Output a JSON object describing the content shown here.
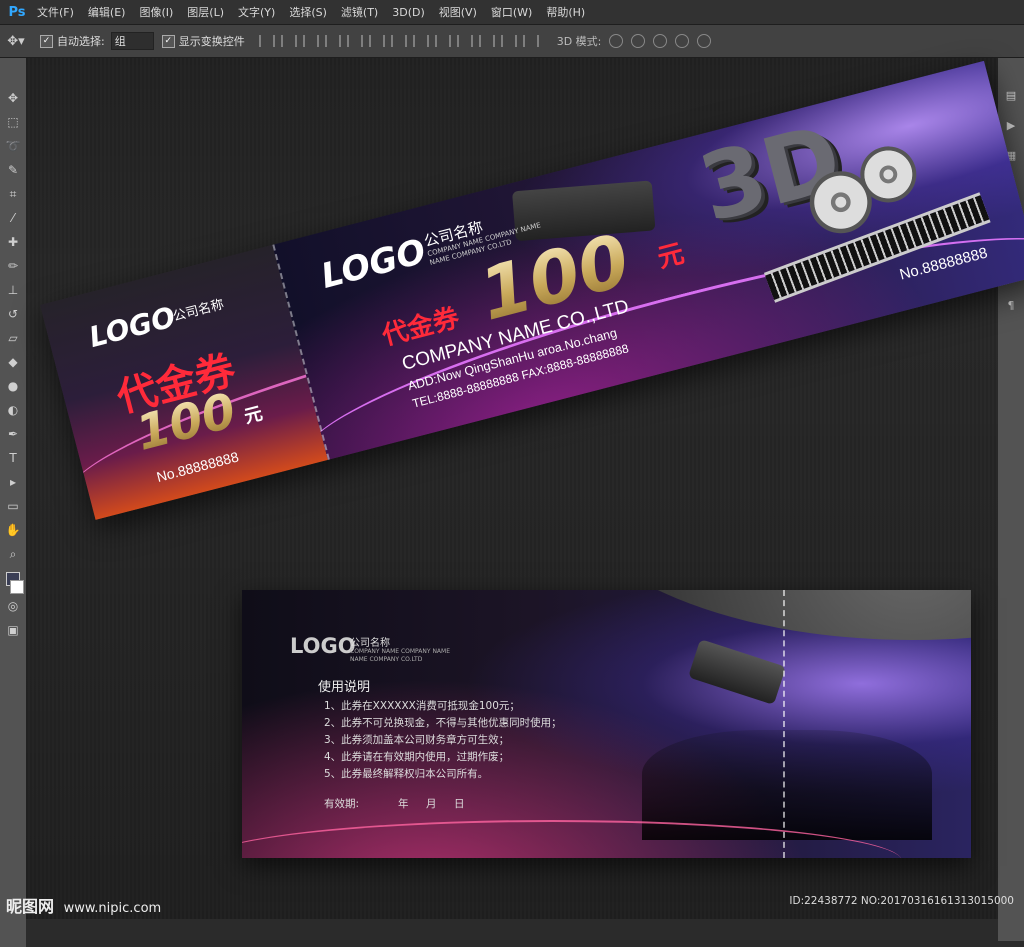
{
  "app": {
    "logo": "Ps"
  },
  "menu": [
    "文件(F)",
    "编辑(E)",
    "图像(I)",
    "图层(L)",
    "文字(Y)",
    "选择(S)",
    "滤镜(T)",
    "3D(D)",
    "视图(V)",
    "窗口(W)",
    "帮助(H)"
  ],
  "options": {
    "auto_select_label": "自动选择:",
    "auto_select_value": "组",
    "show_transform_label": "显示变换控件",
    "mode3d_label": "3D 模式:"
  },
  "colors": {
    "foreground": "#3a3e55",
    "background": "#ffffff",
    "accent": "#ff2a3a"
  },
  "ticket_front": {
    "stub": {
      "logo": "LOGO",
      "company_cn": "公司名称",
      "title": "代金券",
      "amount": "100",
      "unit": "元",
      "serial": "No.88888888"
    },
    "main": {
      "logo": "LOGO",
      "company_cn": "公司名称",
      "company_sub_1": "COMPANY NAME COMPANY NAME",
      "company_sub_2": "NAME COMPANY CO.LTD",
      "title": "代金券",
      "amount": "100",
      "unit": "元",
      "company_en": "COMPANY NAME CO.,LTD",
      "address": "ADD:Now QingShanHu aroa.No.chang",
      "tel_fax": "TEL:8888-88888888   FAX:8888-88888888",
      "badge_3d": "3D",
      "serial": "No.88888888"
    }
  },
  "ticket_back": {
    "logo": "LOGO",
    "company_cn": "公司名称",
    "company_sub_1": "COMPANY NAME COMPANY NAME",
    "company_sub_2": "NAME COMPANY CO.LTD",
    "usage_title": "使用说明",
    "rules": [
      "1、此券在XXXXXX消费可抵现金100元；",
      "2、此券不可兑换现金，不得与其他优惠同时使用；",
      "3、此券须加盖本公司财务章方可生效；",
      "4、此券请在有效期内使用，过期作废；",
      "5、此券最终解释权归本公司所有。"
    ],
    "validity_label": "有效期:",
    "year": "年",
    "month": "月",
    "day": "日"
  },
  "footer": {
    "site_name": "昵图网",
    "site_url": "www.nipic.com",
    "image_id": "ID:22438772 NO:20170316161313015000"
  }
}
